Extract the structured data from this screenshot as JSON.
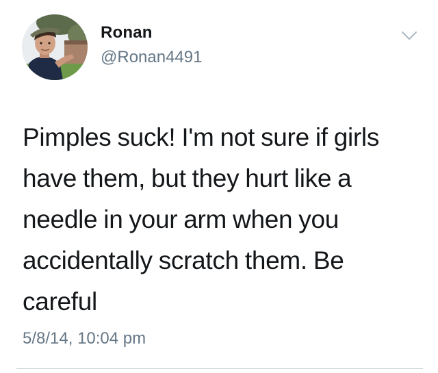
{
  "tweet": {
    "author": {
      "display_name": "Ronan",
      "handle": "@Ronan4491",
      "avatar_icon": "profile-photo"
    },
    "text": "Pimples suck! I'm not sure if girls have them, but they hurt like a needle in your arm when you accidentally scratch them. Be careful",
    "timestamp": "5/8/14, 10:04 pm",
    "menu_icon": "chevron-down-icon"
  },
  "colors": {
    "text_primary": "#14171a",
    "text_secondary": "#657786",
    "chevron": "#aab8c2",
    "divider": "#d6d9db"
  }
}
